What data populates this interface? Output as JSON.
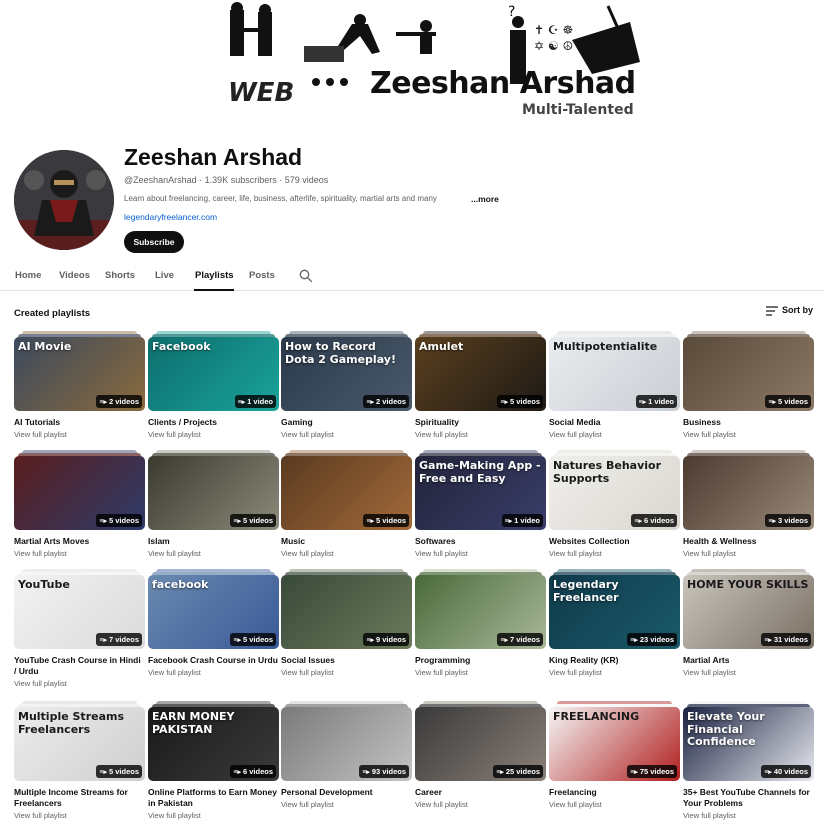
{
  "banner": {
    "name": "Zeeshan Arshad",
    "tagline": "Multi-Talented",
    "web_label": "WEB"
  },
  "channel": {
    "title": "Zeeshan Arshad",
    "meta": "@ZeeshanArshad · 1.39K subscribers · 579 videos",
    "description": "Learn about freelancing, career, life, business, afterlife, spirituality, martial arts and many",
    "more_label": "...more",
    "link": "legendaryfreelancer.com",
    "subscribe_label": "Subscribe"
  },
  "tabs": [
    {
      "label": "Home"
    },
    {
      "label": "Videos"
    },
    {
      "label": "Shorts"
    },
    {
      "label": "Live"
    },
    {
      "label": "Playlists"
    },
    {
      "label": "Posts"
    }
  ],
  "section": {
    "title": "Created playlists",
    "sort_label": "Sort by"
  },
  "playlists": [
    {
      "title": "AI Tutorials",
      "count": "2 videos",
      "link": "View full playlist",
      "thumb_text": "AI Movie",
      "colors": [
        "#3c4a5e",
        "#8a6a3c"
      ]
    },
    {
      "title": "Clients / Projects",
      "count": "1 video",
      "link": "View full playlist",
      "thumb_text": "Facebook",
      "colors": [
        "#0d6e6e",
        "#1aa39a"
      ]
    },
    {
      "title": "Gaming",
      "count": "2 videos",
      "link": "View full playlist",
      "thumb_text": "How to Record Dota 2 Gameplay!",
      "colors": [
        "#2a3a4a",
        "#4a5a6a"
      ]
    },
    {
      "title": "Spirituality",
      "count": "5 videos",
      "link": "View full playlist",
      "thumb_text": "Amulet",
      "colors": [
        "#5a3f1e",
        "#1e1a16"
      ]
    },
    {
      "title": "Social Media",
      "count": "1 video",
      "link": "View full playlist",
      "thumb_text": "Multipotentialite",
      "colors": [
        "#e9ecef",
        "#c9ced3"
      ]
    },
    {
      "title": "Business",
      "count": "5 videos",
      "link": "View full playlist",
      "thumb_text": "",
      "colors": [
        "#5a4a3a",
        "#8c7a66"
      ]
    },
    {
      "title": "Martial Arts Moves",
      "count": "5 videos",
      "link": "View full playlist",
      "thumb_text": "",
      "colors": [
        "#5a1e1e",
        "#2d3b6a"
      ]
    },
    {
      "title": "Islam",
      "count": "5 videos",
      "link": "View full playlist",
      "thumb_text": "",
      "colors": [
        "#3a3a30",
        "#8c8a7a"
      ]
    },
    {
      "title": "Music",
      "count": "5 videos",
      "link": "View full playlist",
      "thumb_text": "",
      "colors": [
        "#5a3a20",
        "#a36a3a"
      ]
    },
    {
      "title": "Softwares",
      "count": "1 video",
      "link": "View full playlist",
      "thumb_text": "Game-Making App - Free and Easy",
      "colors": [
        "#22243a",
        "#3a3e6a"
      ]
    },
    {
      "title": "Websites Collection",
      "count": "6 videos",
      "link": "View full playlist",
      "thumb_text": "Natures Behavior Supports",
      "colors": [
        "#f0efeb",
        "#d9d6cf"
      ]
    },
    {
      "title": "Health & Wellness",
      "count": "3 videos",
      "link": "View full playlist",
      "thumb_text": "",
      "colors": [
        "#4a3a30",
        "#9a8a7a"
      ]
    },
    {
      "title": "YouTube Crash Course in Hindi / Urdu",
      "count": "7 videos",
      "link": "View full playlist",
      "thumb_text": "YouTube",
      "colors": [
        "#f2f2f2",
        "#dadada"
      ]
    },
    {
      "title": "Facebook Crash Course in Urdu",
      "count": "5 videos",
      "link": "View full playlist",
      "thumb_text": "facebook",
      "colors": [
        "#6a8ab0",
        "#3b5998"
      ]
    },
    {
      "title": "Social Issues",
      "count": "9 videos",
      "link": "View full playlist",
      "thumb_text": "",
      "colors": [
        "#3a4a3a",
        "#6a7a5a"
      ]
    },
    {
      "title": "Programming",
      "count": "7 videos",
      "link": "View full playlist",
      "thumb_text": "",
      "colors": [
        "#4a6a3a",
        "#a8b89a"
      ]
    },
    {
      "title": "King Reality (KR)",
      "count": "23 videos",
      "link": "View full playlist",
      "thumb_text": "Legendary Freelancer",
      "colors": [
        "#0f3a4a",
        "#1a5a6a"
      ]
    },
    {
      "title": "Martial Arts",
      "count": "31 videos",
      "link": "View full playlist",
      "thumb_text": "HOME YOUR SKILLS",
      "colors": [
        "#c8c4bc",
        "#7a7064"
      ]
    },
    {
      "title": "Multiple Income Streams for Freelancers",
      "count": "5 videos",
      "link": "View full playlist",
      "thumb_text": "Multiple Streams Freelancers",
      "colors": [
        "#ececec",
        "#cfcfcf"
      ]
    },
    {
      "title": "Online Platforms to Earn Money in Pakistan",
      "count": "6 videos",
      "link": "View full playlist",
      "thumb_text": "EARN MONEY PAKISTAN",
      "colors": [
        "#1a1a1a",
        "#3a3a3a"
      ]
    },
    {
      "title": "Personal Development",
      "count": "93 videos",
      "link": "View full playlist",
      "thumb_text": "",
      "colors": [
        "#7a7a7a",
        "#c4c4c4"
      ]
    },
    {
      "title": "Career",
      "count": "25 videos",
      "link": "View full playlist",
      "thumb_text": "",
      "colors": [
        "#3a3a3a",
        "#8a8078"
      ]
    },
    {
      "title": "Freelancing",
      "count": "75 videos",
      "link": "View full playlist",
      "thumb_text": "FREELANCING",
      "colors": [
        "#f5f5f5",
        "#b01e1e"
      ]
    },
    {
      "title": "35+ Best YouTube Channels for Your Problems",
      "count": "40 videos",
      "link": "View full playlist",
      "thumb_text": "Elevate Your Financial Confidence",
      "colors": [
        "#1a2240",
        "#e8eaf0"
      ]
    }
  ]
}
